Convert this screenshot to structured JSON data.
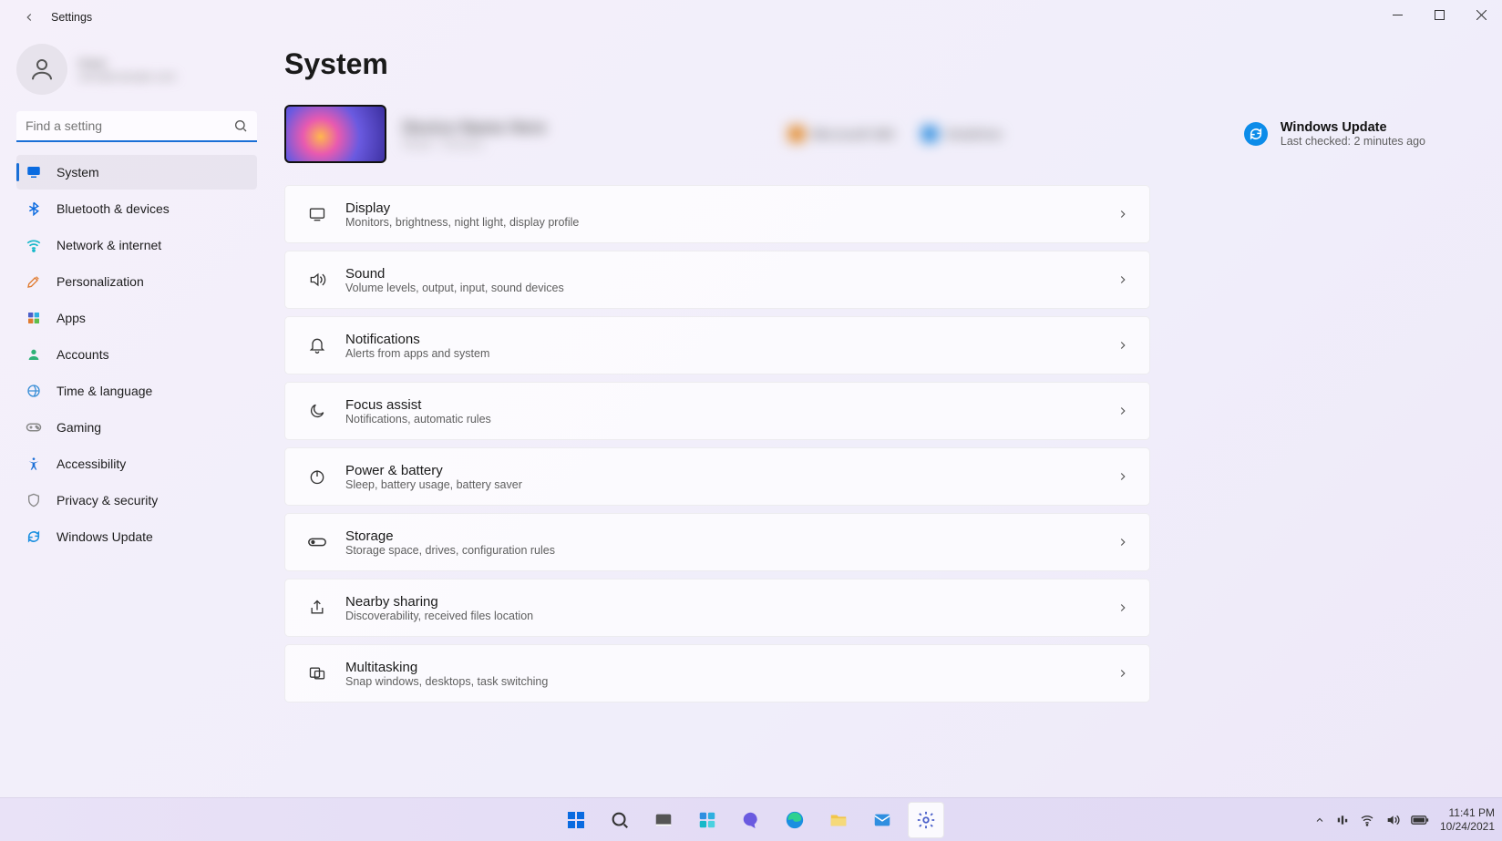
{
  "window": {
    "app_title": "Settings"
  },
  "account": {
    "name": "User",
    "email": "user@example.com"
  },
  "search": {
    "placeholder": "Find a setting"
  },
  "sidebar": {
    "items": [
      {
        "id": "system",
        "label": "System",
        "icon": "system-icon",
        "active": true
      },
      {
        "id": "bluetooth",
        "label": "Bluetooth & devices",
        "icon": "bluetooth-icon"
      },
      {
        "id": "network",
        "label": "Network & internet",
        "icon": "wifi-icon"
      },
      {
        "id": "personalization",
        "label": "Personalization",
        "icon": "brush-icon"
      },
      {
        "id": "apps",
        "label": "Apps",
        "icon": "apps-icon"
      },
      {
        "id": "accounts",
        "label": "Accounts",
        "icon": "person-icon"
      },
      {
        "id": "time",
        "label": "Time & language",
        "icon": "globe-clock-icon"
      },
      {
        "id": "gaming",
        "label": "Gaming",
        "icon": "gamepad-icon"
      },
      {
        "id": "accessibility",
        "label": "Accessibility",
        "icon": "accessibility-icon"
      },
      {
        "id": "privacy",
        "label": "Privacy & security",
        "icon": "shield-icon"
      },
      {
        "id": "update",
        "label": "Windows Update",
        "icon": "update-icon"
      }
    ]
  },
  "page": {
    "title": "System"
  },
  "windows_update": {
    "title": "Windows Update",
    "subtitle": "Last checked: 2 minutes ago"
  },
  "settings_items": [
    {
      "id": "display",
      "title": "Display",
      "desc": "Monitors, brightness, night light, display profile",
      "icon": "display-icon"
    },
    {
      "id": "sound",
      "title": "Sound",
      "desc": "Volume levels, output, input, sound devices",
      "icon": "sound-icon"
    },
    {
      "id": "notifications",
      "title": "Notifications",
      "desc": "Alerts from apps and system",
      "icon": "bell-icon"
    },
    {
      "id": "focus",
      "title": "Focus assist",
      "desc": "Notifications, automatic rules",
      "icon": "moon-icon"
    },
    {
      "id": "power",
      "title": "Power & battery",
      "desc": "Sleep, battery usage, battery saver",
      "icon": "power-icon"
    },
    {
      "id": "storage",
      "title": "Storage",
      "desc": "Storage space, drives, configuration rules",
      "icon": "storage-icon"
    },
    {
      "id": "nearby",
      "title": "Nearby sharing",
      "desc": "Discoverability, received files location",
      "icon": "share-icon"
    },
    {
      "id": "multitask",
      "title": "Multitasking",
      "desc": "Snap windows, desktops, task switching",
      "icon": "multitask-icon"
    }
  ],
  "taskbar": {
    "apps": [
      {
        "id": "start",
        "name": "start-icon"
      },
      {
        "id": "search",
        "name": "search-icon"
      },
      {
        "id": "taskview",
        "name": "task-view-icon"
      },
      {
        "id": "widgets",
        "name": "widgets-icon"
      },
      {
        "id": "teams",
        "name": "chat-icon"
      },
      {
        "id": "edge",
        "name": "edge-icon"
      },
      {
        "id": "explorer",
        "name": "file-explorer-icon"
      },
      {
        "id": "mail",
        "name": "mail-icon"
      },
      {
        "id": "settings",
        "name": "settings-icon",
        "active": true
      }
    ]
  },
  "tray": {
    "time": "11:41 PM",
    "date": "10/24/2021"
  }
}
